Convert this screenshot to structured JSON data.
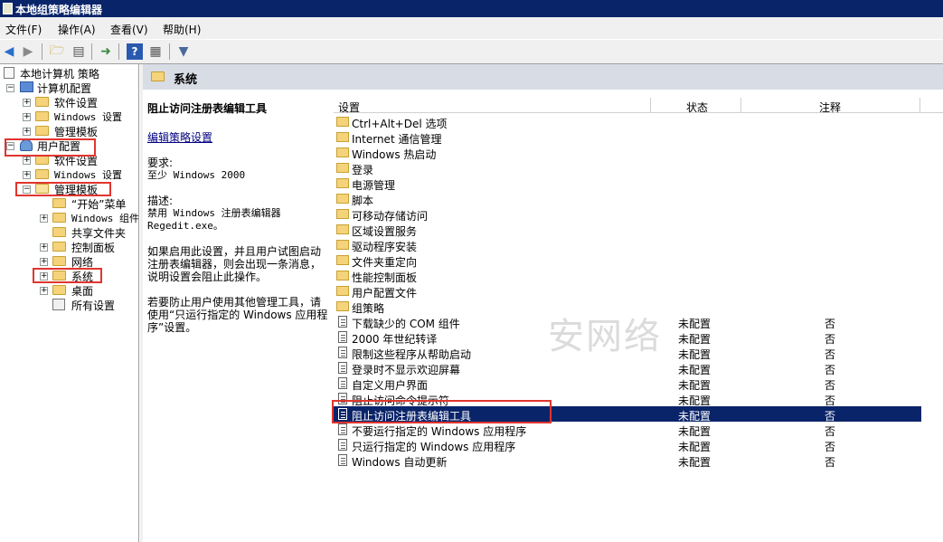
{
  "window": {
    "title": "本地组策略编辑器"
  },
  "menubar": {
    "items": [
      {
        "label": "文件(F)"
      },
      {
        "label": "操作(A)"
      },
      {
        "label": "查看(V)"
      },
      {
        "label": "帮助(H)"
      }
    ]
  },
  "toolbar": {
    "buttons": [
      "back-icon",
      "forward-icon",
      "up-folder-icon",
      "show-hide-tree-icon",
      "export-list-icon",
      "help-icon",
      "properties-icon",
      "filter-icon"
    ]
  },
  "tree": {
    "root": "本地计算机 策略",
    "computer": "计算机配置",
    "software": "软件设置",
    "windows_settings": "Windows 设置",
    "admin_templates": "管理模板",
    "user": "用户配置",
    "u_software": "软件设置",
    "u_windows_settings": "Windows 设置",
    "u_admin_templates": "管理模板",
    "start_menu": "“开始”菜单",
    "win_components": "Windows 组件",
    "shared_folders": "共享文件夹",
    "control_panel": "控制面板",
    "network": "网络",
    "system": "系统",
    "desktop": "桌面",
    "all_settings": "所有设置"
  },
  "panel": {
    "header": "系统"
  },
  "description": {
    "title": "阻止访问注册表编辑工具",
    "edit_link": "编辑策略设置",
    "requirements_label": "要求:",
    "requirements": "至少 Windows 2000",
    "desc_label": "描述:",
    "desc_line1": "禁用 Windows 注册表编辑器",
    "desc_line2": "Regedit.exe。",
    "para1": "如果启用此设置，并且用户试图启动注册表编辑器，则会出现一条消息，说明设置会阻止此操作。",
    "para2": "若要防止用户使用其他管理工具，请使用“只运行指定的 Windows 应用程序”设置。"
  },
  "list": {
    "columns": {
      "setting": "设置",
      "state": "状态",
      "comment": "注释"
    },
    "folders": [
      "Ctrl+Alt+Del 选项",
      "Internet 通信管理",
      "Windows 热启动",
      "登录",
      "电源管理",
      "脚本",
      "可移动存储访问",
      "区域设置服务",
      "驱动程序安装",
      "文件夹重定向",
      "性能控制面板",
      "用户配置文件",
      "组策略"
    ],
    "policies": [
      {
        "name": "下载缺少的 COM 组件",
        "state": "未配置",
        "comment": "否"
      },
      {
        "name": "2000 年世纪转译",
        "state": "未配置",
        "comment": "否"
      },
      {
        "name": "限制这些程序从帮助启动",
        "state": "未配置",
        "comment": "否"
      },
      {
        "name": "登录时不显示欢迎屏幕",
        "state": "未配置",
        "comment": "否"
      },
      {
        "name": "自定义用户界面",
        "state": "未配置",
        "comment": "否"
      },
      {
        "name": "阻止访问命令提示符",
        "state": "未配置",
        "comment": "否"
      },
      {
        "name": "阻止访问注册表编辑工具",
        "state": "未配置",
        "comment": "否"
      },
      {
        "name": "不要运行指定的 Windows 应用程序",
        "state": "未配置",
        "comment": "否"
      },
      {
        "name": "只运行指定的 Windows 应用程序",
        "state": "未配置",
        "comment": "否"
      },
      {
        "name": "Windows 自动更新",
        "state": "未配置",
        "comment": "否"
      }
    ],
    "selected_policy": "阻止访问注册表编辑工具"
  },
  "watermark": "安网络",
  "colors": {
    "selection": "#0a246a",
    "highlight_box": "#e0352f",
    "titlebar": "#0a246a"
  }
}
